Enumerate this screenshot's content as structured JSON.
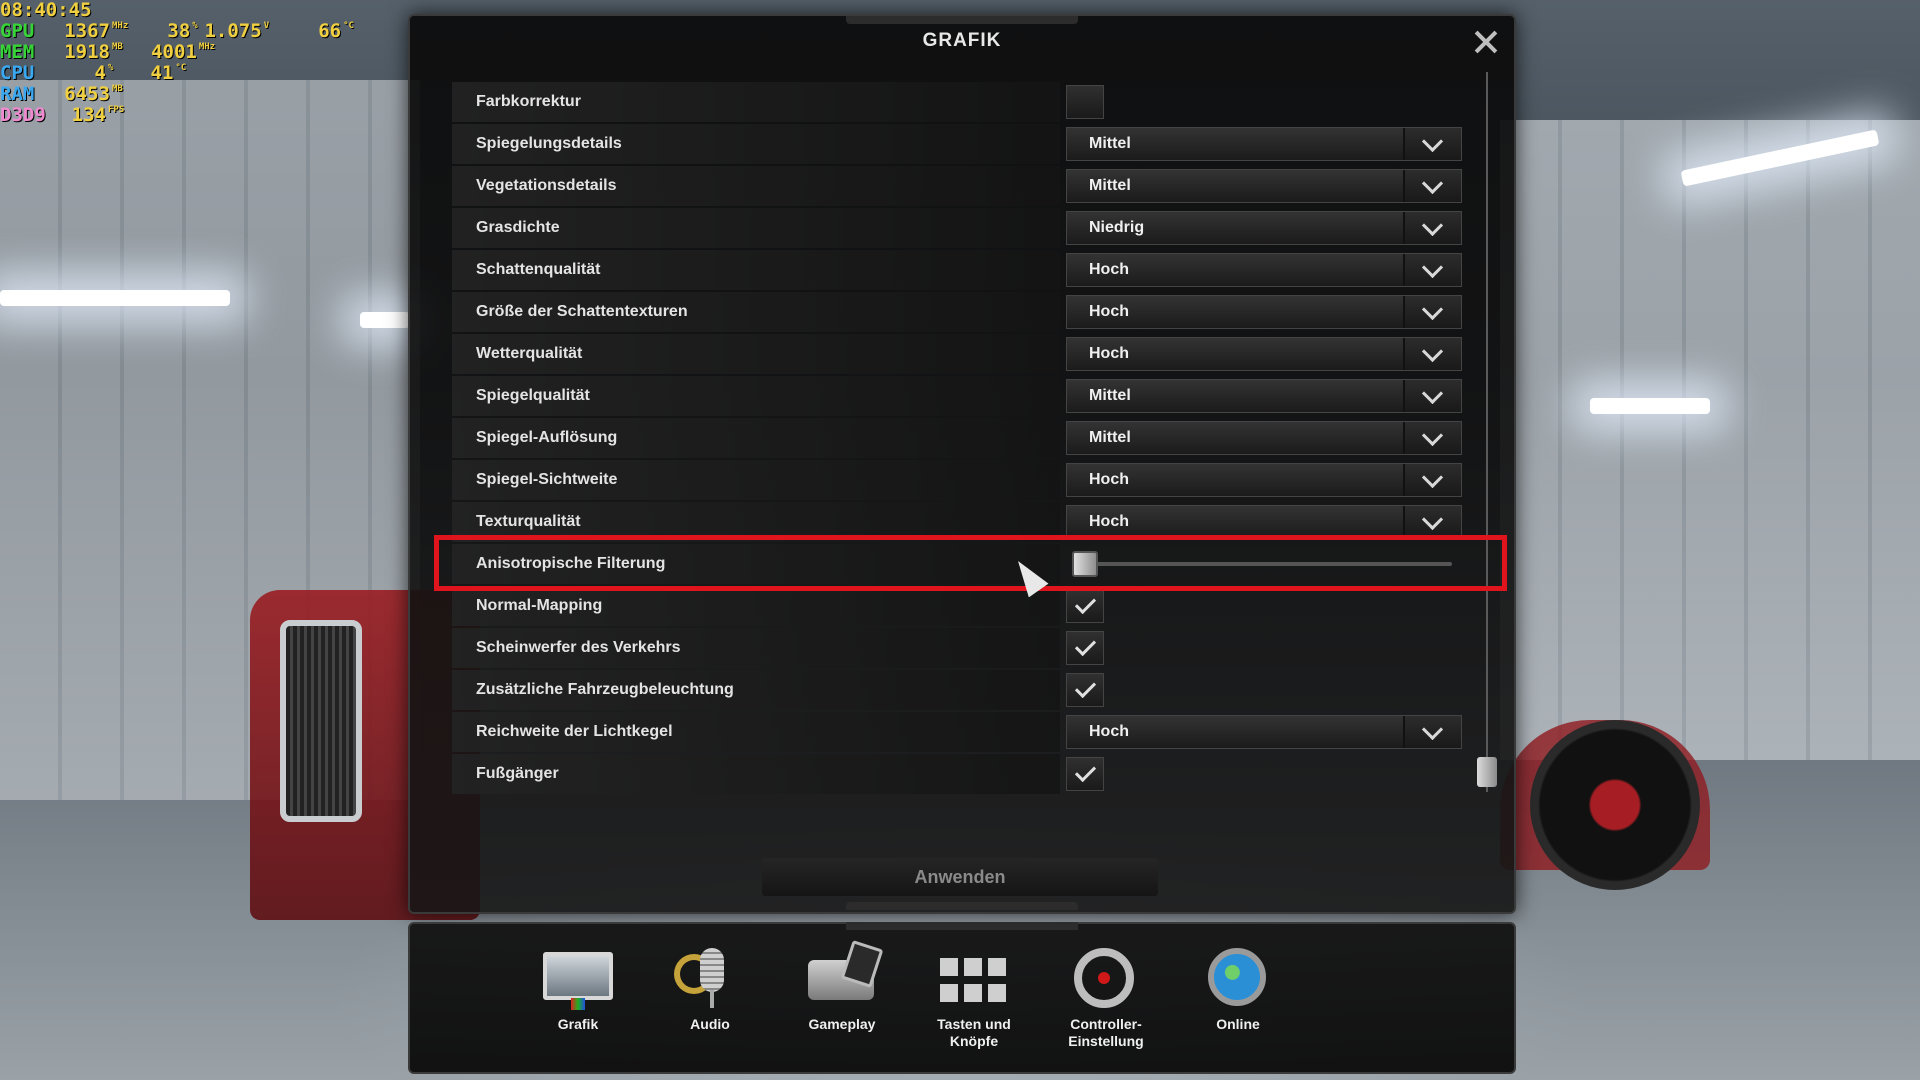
{
  "osd": {
    "time": "08:40:45",
    "rows": [
      {
        "label": "GPU",
        "items": [
          {
            "v": "1367",
            "u": "MHz"
          },
          {
            "v": "38",
            "u": "%"
          },
          {
            "v": "1.075",
            "u": "V"
          },
          {
            "v": "66",
            "u": "°C"
          }
        ]
      },
      {
        "label": "MEM",
        "items": [
          {
            "v": "1918",
            "u": "MB"
          },
          {
            "v": "4001",
            "u": "MHz"
          }
        ]
      },
      {
        "label": "CPU",
        "items": [
          {
            "v": "4",
            "u": "%"
          },
          {
            "v": "41",
            "u": "°C"
          }
        ]
      },
      {
        "label": "RAM",
        "items": [
          {
            "v": "6453",
            "u": "MB"
          }
        ]
      },
      {
        "label": "D3D9",
        "items": [
          {
            "v": "134",
            "u": "FPS"
          }
        ]
      }
    ]
  },
  "dialog": {
    "title": "GRAFIK",
    "apply_label": "Anwenden",
    "settings": [
      {
        "label": "Farbkorrektur",
        "type": "checkbox",
        "checked": false
      },
      {
        "label": "Spiegelungsdetails",
        "type": "select",
        "value": "Mittel"
      },
      {
        "label": "Vegetationsdetails",
        "type": "select",
        "value": "Mittel"
      },
      {
        "label": "Grasdichte",
        "type": "select",
        "value": "Niedrig"
      },
      {
        "label": "Schattenqualität",
        "type": "select",
        "value": "Hoch"
      },
      {
        "label": "Größe der Schattentexturen",
        "type": "select",
        "value": "Hoch"
      },
      {
        "label": "Wetterqualität",
        "type": "select",
        "value": "Hoch"
      },
      {
        "label": "Spiegelqualität",
        "type": "select",
        "value": "Mittel"
      },
      {
        "label": "Spiegel-Auflösung",
        "type": "select",
        "value": "Mittel"
      },
      {
        "label": "Spiegel-Sichtweite",
        "type": "select",
        "value": "Hoch"
      },
      {
        "label": "Texturqualität",
        "type": "select",
        "value": "Hoch"
      },
      {
        "label": "Anisotropische Filterung",
        "type": "slider",
        "value": 0.0
      },
      {
        "label": "Normal-Mapping",
        "type": "checkbox",
        "checked": true
      },
      {
        "label": "Scheinwerfer des Verkehrs",
        "type": "checkbox",
        "checked": true
      },
      {
        "label": "Zusätzliche Fahrzeugbeleuchtung",
        "type": "checkbox",
        "checked": true
      },
      {
        "label": "Reichweite der Lichtkegel",
        "type": "select",
        "value": "Hoch"
      },
      {
        "label": "Fußgänger",
        "type": "checkbox",
        "checked": true
      }
    ],
    "scroll_position": 1.0
  },
  "tabs": [
    {
      "label": "Grafik",
      "icon": "monitor-icon"
    },
    {
      "label": "Audio",
      "icon": "microphone-icon"
    },
    {
      "label": "Gameplay",
      "icon": "truck-icon"
    },
    {
      "label": "Tasten und\nKnöpfe",
      "icon": "keyboard-keys-icon"
    },
    {
      "label": "Controller-\nEinstellung",
      "icon": "steering-wheel-icon"
    },
    {
      "label": "Online",
      "icon": "globe-icon"
    }
  ],
  "colors": {
    "highlight": "#e0141c",
    "osd_value": "#f0d040"
  }
}
